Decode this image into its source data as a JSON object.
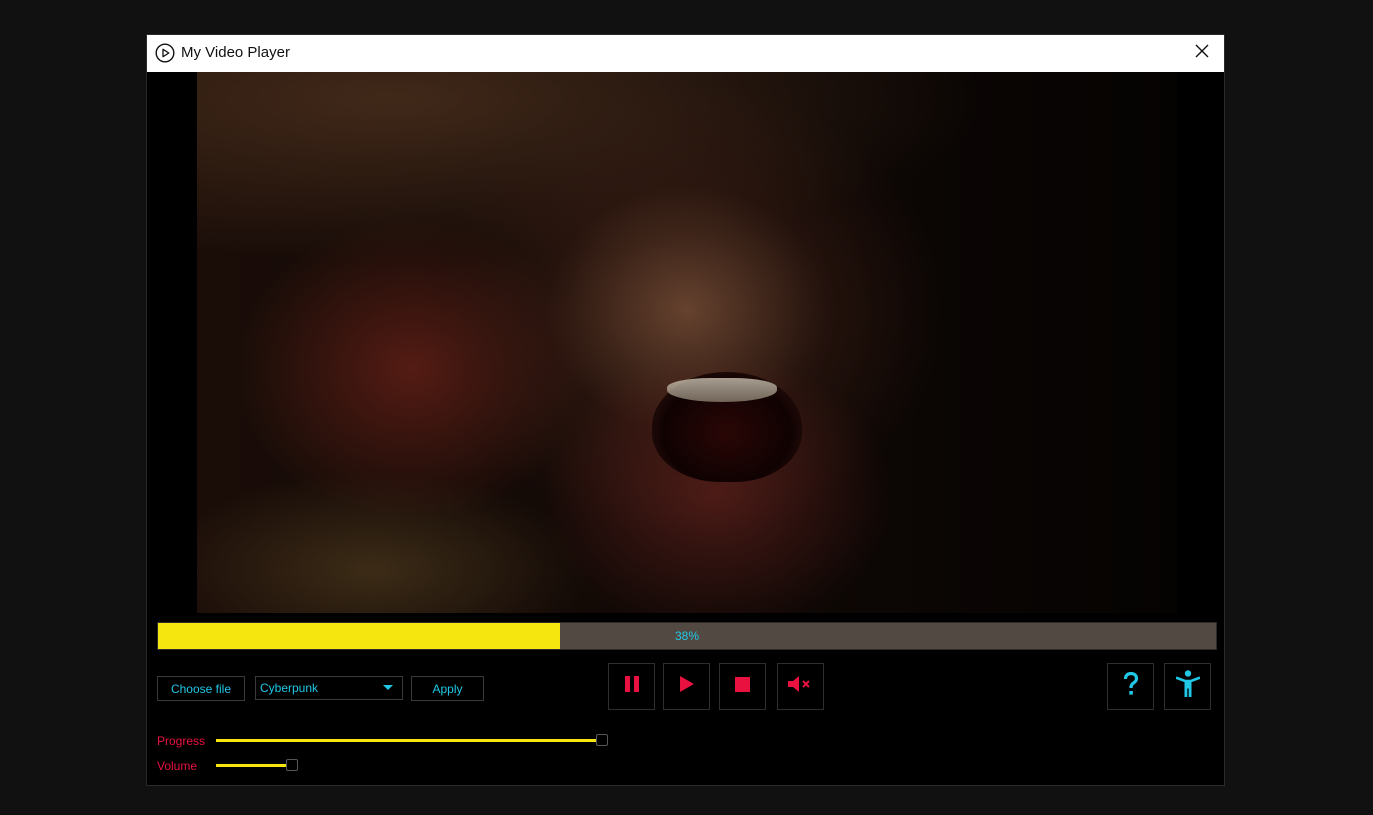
{
  "window": {
    "title": "My Video Player"
  },
  "playback": {
    "progress_fraction": 0.38,
    "progress_text": "38%"
  },
  "controls": {
    "choose_file_label": "Choose file",
    "theme_selected": "Cyberpunk",
    "apply_label": "Apply",
    "buttons": [
      "pause-icon",
      "play-icon",
      "stop-icon",
      "mute-icon",
      "help-icon",
      "accessibility-icon"
    ]
  },
  "sliders": {
    "progress_label": "Progress",
    "progress_value": 0.97,
    "volume_label": "Volume",
    "volume_value": 0.85
  },
  "colors": {
    "accent_yellow": "#f5e60f",
    "accent_cyan": "#20c8e6",
    "accent_red": "#e8113f",
    "bar_background": "#524942"
  }
}
